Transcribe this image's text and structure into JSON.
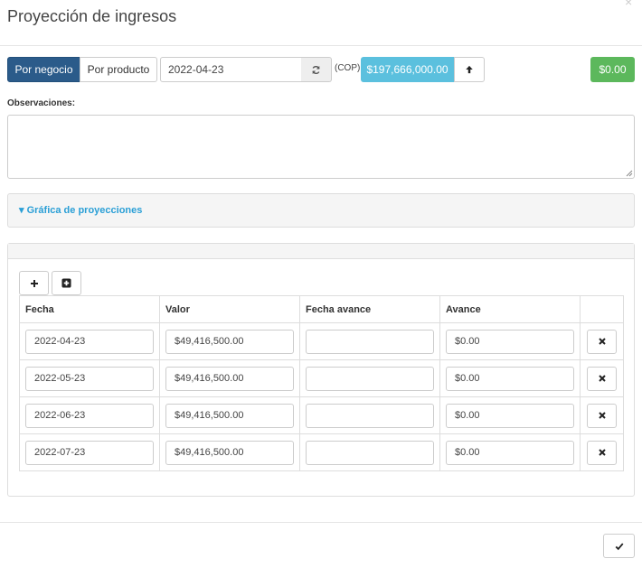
{
  "dialog": {
    "title": "Proyección de ingresos",
    "close_symbol": "×"
  },
  "toolbar": {
    "modes": [
      {
        "label": "Por negocio",
        "active": true
      },
      {
        "label": "Por producto",
        "active": false
      }
    ],
    "date_value": "2022-04-23",
    "currency_note": "(COP)",
    "total_amount": "$197,666,000.00",
    "balance_amount": "$0.00",
    "icons": {
      "refresh": "refresh-icon",
      "up": "arrow-up-icon"
    }
  },
  "observations": {
    "label": "Observaciones:",
    "value": ""
  },
  "chart_panel": {
    "caret": "▾",
    "label": "Gráfica de proyecciones"
  },
  "table": {
    "actions": {
      "add": "plus-icon",
      "add_square": "plus-square-icon"
    },
    "headers": [
      "Fecha",
      "Valor",
      "Fecha avance",
      "Avance",
      ""
    ],
    "rows": [
      {
        "fecha": "2022-04-23",
        "valor": "$49,416,500.00",
        "fecha_avance": "",
        "avance": "$0.00"
      },
      {
        "fecha": "2022-05-23",
        "valor": "$49,416,500.00",
        "fecha_avance": "",
        "avance": "$0.00"
      },
      {
        "fecha": "2022-06-23",
        "valor": "$49,416,500.00",
        "fecha_avance": "",
        "avance": "$0.00"
      },
      {
        "fecha": "2022-07-23",
        "valor": "$49,416,500.00",
        "fecha_avance": "",
        "avance": "$0.00"
      }
    ]
  },
  "footer": {
    "confirm_icon": "check-icon"
  },
  "colors": {
    "primary": "#2b5b8a",
    "info": "#5bc0de",
    "success": "#5cb85c",
    "link": "#2a9fd6"
  }
}
